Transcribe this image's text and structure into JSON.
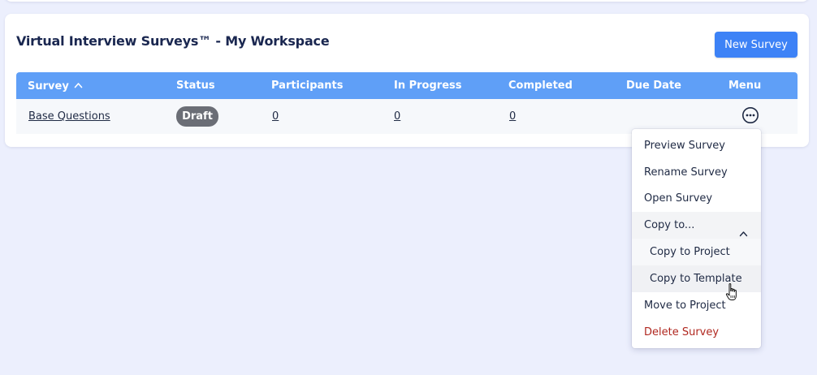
{
  "panel": {
    "title": "Virtual Interview Surveys™ - My Workspace",
    "new_button": "New Survey"
  },
  "table": {
    "headers": {
      "survey": "Survey",
      "status": "Status",
      "participants": "Participants",
      "in_progress": "In Progress",
      "completed": "Completed",
      "due_date": "Due Date",
      "menu": "Menu"
    },
    "sort": {
      "column": "Survey",
      "direction": "ascending",
      "icon": "chevron-up-icon"
    },
    "rows": [
      {
        "survey": "Base Questions",
        "status": "Draft",
        "participants": "0",
        "in_progress": "0",
        "completed": "0",
        "due_date": ""
      }
    ]
  },
  "menu": {
    "items": {
      "preview": "Preview Survey",
      "rename": "Rename Survey",
      "open": "Open Survey",
      "copy_to": "Copy to...",
      "copy_to_project": "Copy to Project",
      "copy_to_template": "Copy to Template",
      "move_to_project": "Move to Project",
      "delete": "Delete Survey"
    },
    "expanded_group": "Copy to...",
    "hovered_item": "Copy to Template"
  },
  "colors": {
    "background": "#eceffd",
    "header_bg": "#5f9ff7",
    "button_bg": "#3d82f6",
    "draft_badge": "#6b6e76",
    "danger": "#b0271f",
    "title_text": "#1a2750"
  }
}
